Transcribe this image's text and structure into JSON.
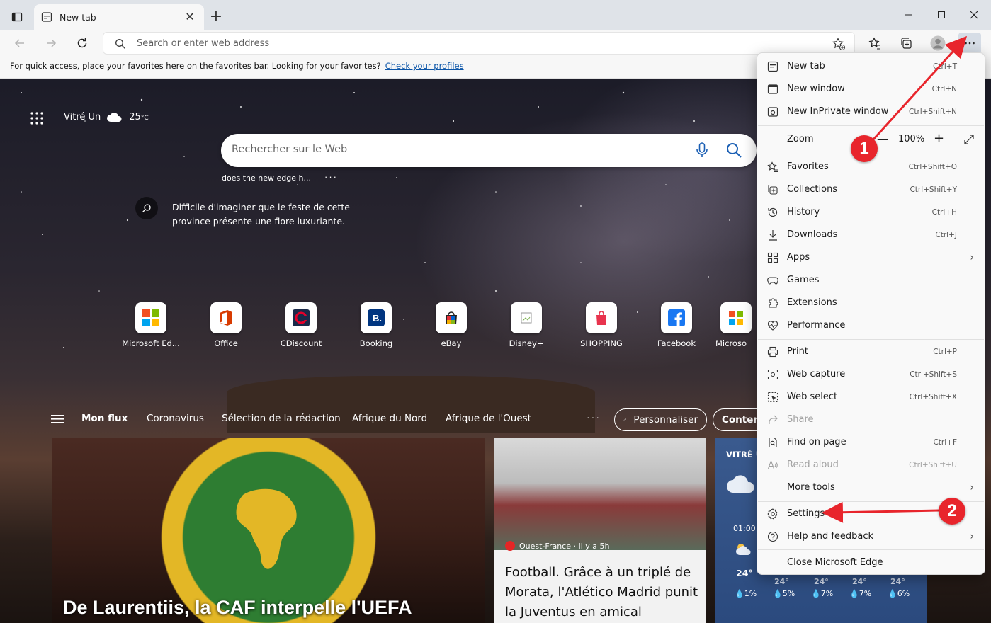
{
  "titlebar": {
    "tab_title": "New tab",
    "new_tab_symbol": "+",
    "close_symbol": "✕"
  },
  "toolbar": {
    "address_placeholder": "Search or enter web address"
  },
  "favorites_bar": {
    "message": "For quick access, place your favorites here on the favorites bar. Looking for your favorites?",
    "link": "Check your profiles"
  },
  "page": {
    "location": "Vitré Un",
    "temperature": "25",
    "temperature_unit": "°C",
    "search_placeholder": "Rechercher sur le Web",
    "suggestion": "does the new edge h...",
    "suggestion_more": "···",
    "fact_text": "Difficile d'imaginer que le feste de cette province présente une flore luxuriante.",
    "quick_links": [
      {
        "label": "Microsoft Ed...",
        "icon": "microsoft-logo-icon"
      },
      {
        "label": "Office",
        "icon": "office-logo-icon"
      },
      {
        "label": "CDiscount",
        "icon": "cdiscount-logo-icon"
      },
      {
        "label": "Booking",
        "icon": "booking-logo-icon"
      },
      {
        "label": "eBay",
        "icon": "ebay-logo-icon"
      },
      {
        "label": "Disney+",
        "icon": "broken-image-icon"
      },
      {
        "label": "SHOPPING",
        "icon": "shopping-bag-icon"
      },
      {
        "label": "Facebook",
        "icon": "facebook-logo-icon"
      },
      {
        "label": "Microso",
        "icon": "microsoft-store-icon"
      }
    ],
    "feed_nav": {
      "items": [
        "Mon flux",
        "Coronavirus",
        "Sélection de la rédaction",
        "Afrique du Nord",
        "Afrique de l'Ouest"
      ],
      "more": "···",
      "personalize": "Personnaliser",
      "content": "Contenu"
    },
    "cards": {
      "main_headline": "De Laurentiis, la CAF interpelle l'UEFA",
      "news_source": "Ouest-France · Il y a 5h",
      "news_title": "Football. Grâce à un triplé de Morata, l'Atlético Madrid punit la Juventus en amical",
      "weather_location": "VITRÉ U",
      "weather_time": "01:00",
      "weather_temp": "24°",
      "weather_hours": [
        "24°",
        "24°",
        "24°",
        "24°"
      ],
      "precip": [
        "1%",
        "5%",
        "7%",
        "7%",
        "6%"
      ]
    }
  },
  "menu": {
    "items": [
      {
        "label": "New tab",
        "shortcut": "Ctrl+T",
        "icon": "new-tab-icon"
      },
      {
        "label": "New window",
        "shortcut": "Ctrl+N",
        "icon": "new-window-icon"
      },
      {
        "label": "New InPrivate window",
        "shortcut": "Ctrl+Shift+N",
        "icon": "inprivate-icon"
      },
      {
        "label": "Zoom",
        "value": "100%",
        "minus": "—",
        "plus": "+"
      },
      {
        "label": "Favorites",
        "shortcut": "Ctrl+Shift+O",
        "icon": "favorites-icon"
      },
      {
        "label": "Collections",
        "shortcut": "Ctrl+Shift+Y",
        "icon": "collections-icon"
      },
      {
        "label": "History",
        "shortcut": "Ctrl+H",
        "icon": "history-icon"
      },
      {
        "label": "Downloads",
        "shortcut": "Ctrl+J",
        "icon": "download-icon"
      },
      {
        "label": "Apps",
        "icon": "apps-icon"
      },
      {
        "label": "Games",
        "icon": "games-icon"
      },
      {
        "label": "Extensions",
        "icon": "extensions-icon"
      },
      {
        "label": "Performance",
        "icon": "performance-icon"
      },
      {
        "label": "Print",
        "shortcut": "Ctrl+P",
        "icon": "print-icon"
      },
      {
        "label": "Web capture",
        "shortcut": "Ctrl+Shift+S",
        "icon": "web-capture-icon"
      },
      {
        "label": "Web select",
        "shortcut": "Ctrl+Shift+X",
        "icon": "web-select-icon"
      },
      {
        "label": "Share",
        "icon": "share-icon"
      },
      {
        "label": "Find on page",
        "shortcut": "Ctrl+F",
        "icon": "find-icon"
      },
      {
        "label": "Read aloud",
        "shortcut": "Ctrl+Shift+U",
        "icon": "read-aloud-icon"
      },
      {
        "label": "More tools",
        "icon": ""
      },
      {
        "label": "Settings",
        "icon": "gear-icon"
      },
      {
        "label": "Help and feedback",
        "icon": "help-icon"
      },
      {
        "label": "Close Microsoft Edge",
        "icon": ""
      }
    ]
  },
  "annotations": {
    "badge1": "1",
    "badge2": "2",
    "color": "#e8252c"
  },
  "chevron": "›"
}
